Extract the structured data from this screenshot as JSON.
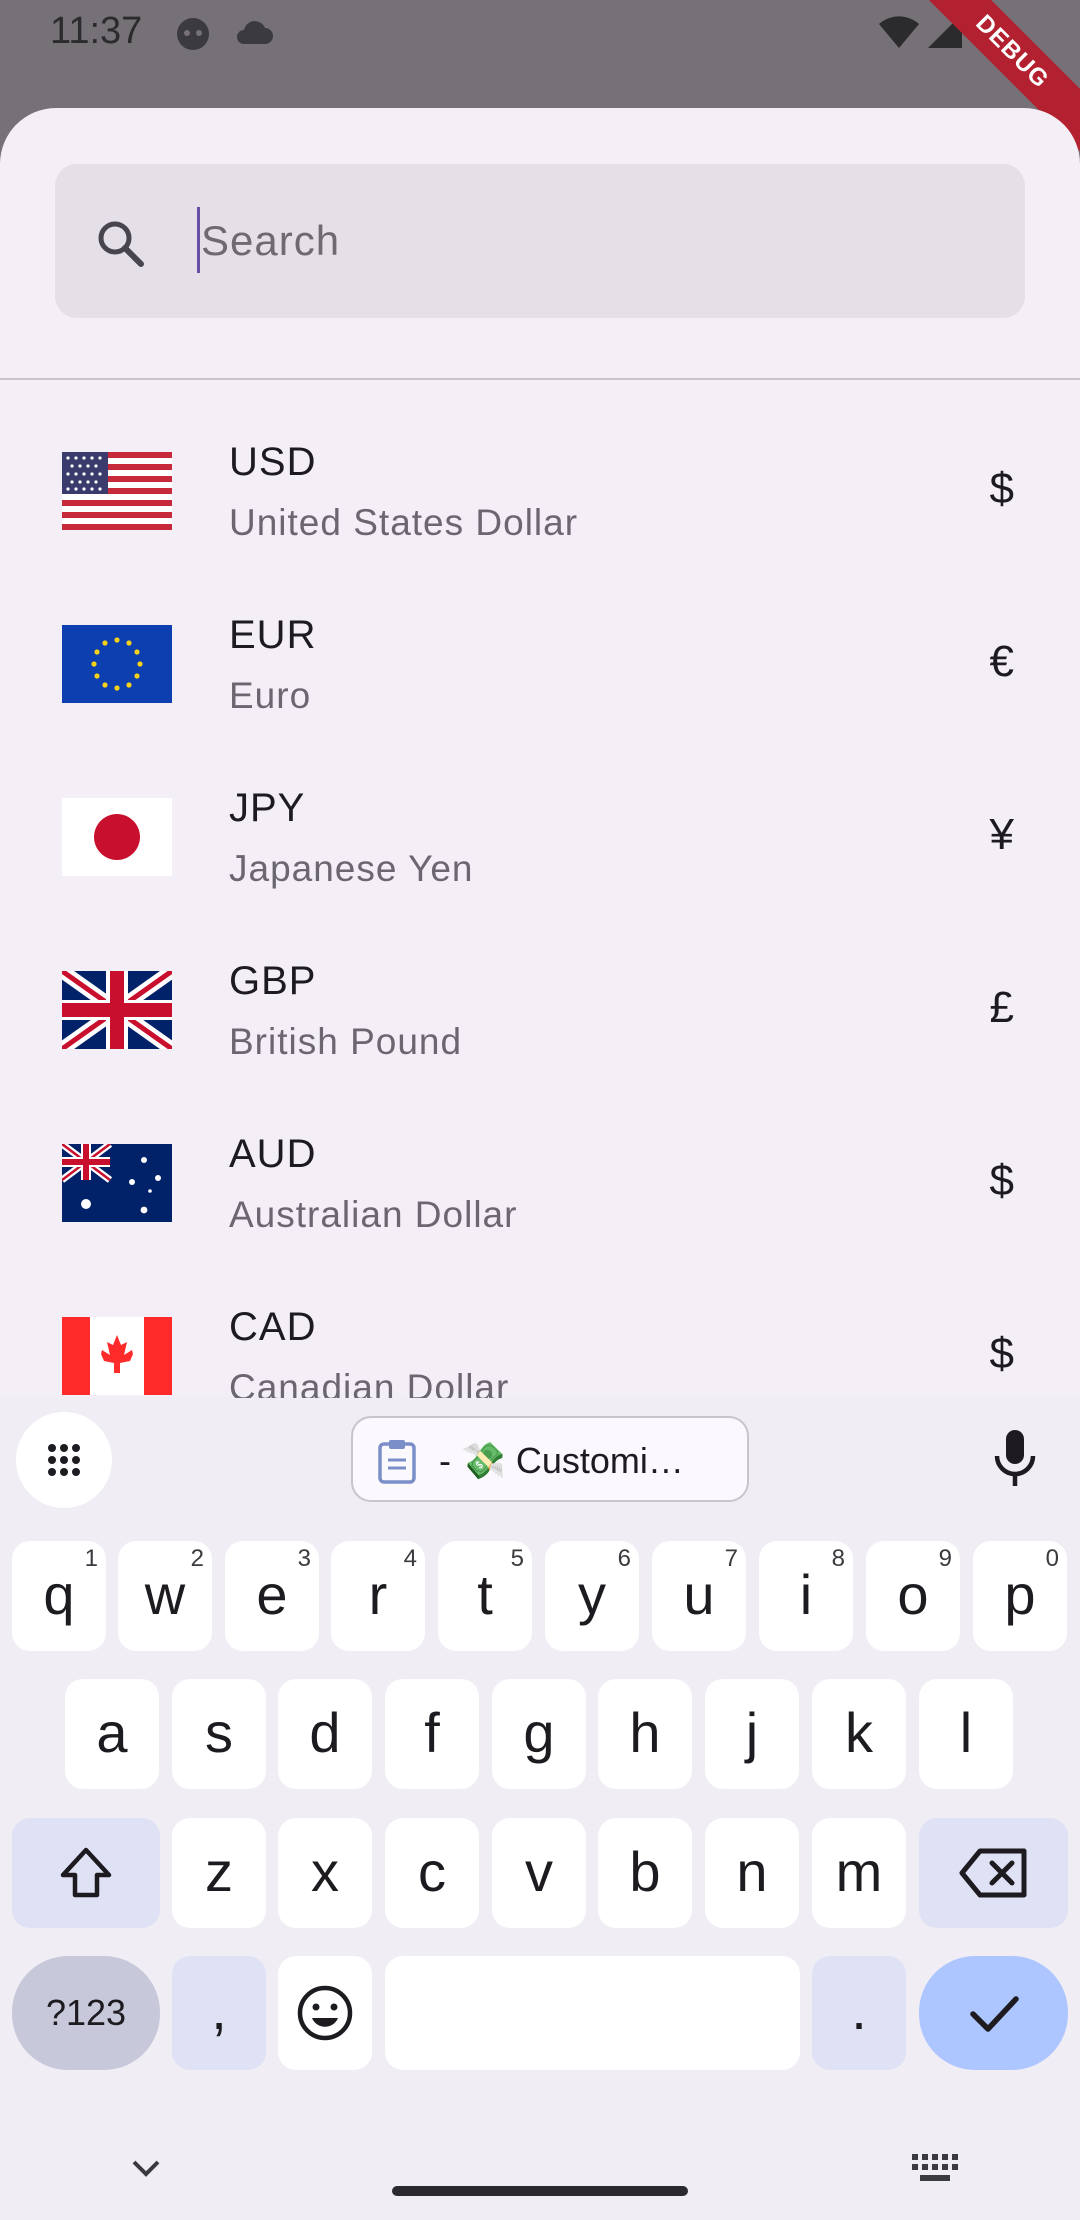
{
  "status_bar": {
    "time": "11:37",
    "icons": [
      "android-face-icon",
      "cloud-icon",
      "wifi-icon",
      "signal-icon"
    ],
    "debug_label": "DEBUG"
  },
  "search": {
    "placeholder": "Search",
    "value": ""
  },
  "currencies": [
    {
      "code": "USD",
      "name": "United States Dollar",
      "symbol": "$",
      "flag": "us-flag-icon"
    },
    {
      "code": "EUR",
      "name": "Euro",
      "symbol": "€",
      "flag": "eu-flag-icon"
    },
    {
      "code": "JPY",
      "name": "Japanese Yen",
      "symbol": "¥",
      "flag": "jp-flag-icon"
    },
    {
      "code": "GBP",
      "name": "British Pound",
      "symbol": "£",
      "flag": "gb-flag-icon"
    },
    {
      "code": "AUD",
      "name": "Australian Dollar",
      "symbol": "$",
      "flag": "au-flag-icon"
    },
    {
      "code": "CAD",
      "name": "Canadian Dollar",
      "symbol": "$",
      "flag": "ca-flag-icon"
    }
  ],
  "keyboard": {
    "clipboard_suggestion": "- 💸 Customi…",
    "row1": [
      {
        "key": "q",
        "hint": "1"
      },
      {
        "key": "w",
        "hint": "2"
      },
      {
        "key": "e",
        "hint": "3"
      },
      {
        "key": "r",
        "hint": "4"
      },
      {
        "key": "t",
        "hint": "5"
      },
      {
        "key": "y",
        "hint": "6"
      },
      {
        "key": "u",
        "hint": "7"
      },
      {
        "key": "i",
        "hint": "8"
      },
      {
        "key": "o",
        "hint": "9"
      },
      {
        "key": "p",
        "hint": "0"
      }
    ],
    "row2": [
      "a",
      "s",
      "d",
      "f",
      "g",
      "h",
      "j",
      "k",
      "l"
    ],
    "row3": [
      "z",
      "x",
      "c",
      "v",
      "b",
      "n",
      "m"
    ],
    "symbols_label": "?123",
    "comma": ",",
    "period": "."
  },
  "colors": {
    "accent": "#6750a4",
    "sheet": "#f4eff6",
    "enter_key": "#adc6ff",
    "debug_banner": "#b3202f"
  }
}
